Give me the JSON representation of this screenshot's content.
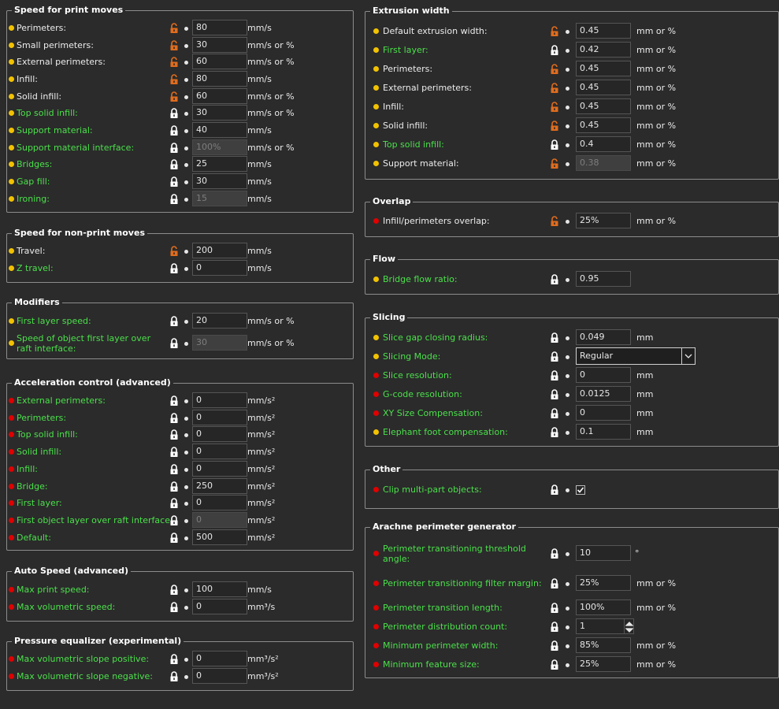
{
  "colors": {
    "accent_green": "#4be04b",
    "unlock_orange": "#e06c1d",
    "bullet_yellow": "#f2c200",
    "bullet_red": "#e00000"
  },
  "left_groups": [
    {
      "title": "Speed for print moves",
      "rows": [
        {
          "bullet": "yellow",
          "label": "Perimeters:",
          "green": false,
          "lock": "unlocked",
          "value": "80",
          "disabled": false,
          "unit": "mm/s"
        },
        {
          "bullet": "yellow",
          "label": "Small perimeters:",
          "green": false,
          "lock": "unlocked",
          "value": "30",
          "disabled": false,
          "unit": "mm/s or %"
        },
        {
          "bullet": "yellow",
          "label": "External perimeters:",
          "green": false,
          "lock": "unlocked",
          "value": "60",
          "disabled": false,
          "unit": "mm/s or %"
        },
        {
          "bullet": "yellow",
          "label": "Infill:",
          "green": false,
          "lock": "unlocked",
          "value": "80",
          "disabled": false,
          "unit": "mm/s"
        },
        {
          "bullet": "yellow",
          "label": "Solid infill:",
          "green": false,
          "lock": "unlocked",
          "value": "60",
          "disabled": false,
          "unit": "mm/s or %"
        },
        {
          "bullet": "yellow",
          "label": "Top solid infill:",
          "green": true,
          "lock": "locked",
          "value": "30",
          "disabled": false,
          "unit": "mm/s or %"
        },
        {
          "bullet": "yellow",
          "label": "Support material:",
          "green": true,
          "lock": "locked",
          "value": "40",
          "disabled": false,
          "unit": "mm/s"
        },
        {
          "bullet": "yellow",
          "label": "Support material interface:",
          "green": true,
          "lock": "locked",
          "value": "100%",
          "disabled": true,
          "unit": "mm/s or %"
        },
        {
          "bullet": "yellow",
          "label": "Bridges:",
          "green": true,
          "lock": "locked",
          "value": "25",
          "disabled": false,
          "unit": "mm/s"
        },
        {
          "bullet": "yellow",
          "label": "Gap fill:",
          "green": true,
          "lock": "locked",
          "value": "30",
          "disabled": false,
          "unit": "mm/s"
        },
        {
          "bullet": "yellow",
          "label": "Ironing:",
          "green": true,
          "lock": "locked",
          "value": "15",
          "disabled": true,
          "unit": "mm/s"
        }
      ]
    },
    {
      "title": "Speed for non-print moves",
      "rows": [
        {
          "bullet": "yellow",
          "label": "Travel:",
          "green": false,
          "lock": "unlocked",
          "value": "200",
          "disabled": false,
          "unit": "mm/s"
        },
        {
          "bullet": "yellow",
          "label": "Z travel:",
          "green": true,
          "lock": "locked",
          "value": "0",
          "disabled": false,
          "unit": "mm/s"
        }
      ]
    },
    {
      "title": "Modifiers",
      "rows": [
        {
          "bullet": "yellow",
          "label": "First layer speed:",
          "green": true,
          "lock": "locked",
          "value": "20",
          "disabled": false,
          "unit": "mm/s or %"
        },
        {
          "bullet": "yellow",
          "label": "Speed of object first layer over raft interface:",
          "green": true,
          "lock": "locked",
          "value": "30",
          "disabled": true,
          "unit": "mm/s or %",
          "two_line": true
        }
      ]
    },
    {
      "title": "Acceleration control (advanced)",
      "rows": [
        {
          "bullet": "red",
          "label": "External perimeters:",
          "green": true,
          "lock": "locked",
          "value": "0",
          "disabled": false,
          "unit": "mm/s²"
        },
        {
          "bullet": "red",
          "label": "Perimeters:",
          "green": true,
          "lock": "locked",
          "value": "0",
          "disabled": false,
          "unit": "mm/s²"
        },
        {
          "bullet": "red",
          "label": "Top solid infill:",
          "green": true,
          "lock": "locked",
          "value": "0",
          "disabled": false,
          "unit": "mm/s²"
        },
        {
          "bullet": "red",
          "label": "Solid infill:",
          "green": true,
          "lock": "locked",
          "value": "0",
          "disabled": false,
          "unit": "mm/s²"
        },
        {
          "bullet": "red",
          "label": "Infill:",
          "green": true,
          "lock": "locked",
          "value": "0",
          "disabled": false,
          "unit": "mm/s²"
        },
        {
          "bullet": "red",
          "label": "Bridge:",
          "green": true,
          "lock": "locked",
          "value": "250",
          "disabled": false,
          "unit": "mm/s²"
        },
        {
          "bullet": "red",
          "label": "First layer:",
          "green": true,
          "lock": "locked",
          "value": "0",
          "disabled": false,
          "unit": "mm/s²"
        },
        {
          "bullet": "red",
          "label": "First object layer over raft interface:",
          "green": true,
          "lock": "locked",
          "value": "0",
          "disabled": true,
          "unit": "mm/s²"
        },
        {
          "bullet": "red",
          "label": "Default:",
          "green": true,
          "lock": "locked",
          "value": "500",
          "disabled": false,
          "unit": "mm/s²"
        }
      ]
    },
    {
      "title": "Auto Speed (advanced)",
      "rows": [
        {
          "bullet": "red",
          "label": "Max print speed:",
          "green": true,
          "lock": "locked",
          "value": "100",
          "disabled": false,
          "unit": "mm/s"
        },
        {
          "bullet": "red",
          "label": "Max volumetric speed:",
          "green": true,
          "lock": "locked",
          "value": "0",
          "disabled": false,
          "unit": "mm³/s"
        }
      ]
    },
    {
      "title": "Pressure equalizer (experimental)",
      "rows": [
        {
          "bullet": "red",
          "label": "Max volumetric slope positive:",
          "green": true,
          "lock": "locked",
          "value": "0",
          "disabled": false,
          "unit": "mm³/s²"
        },
        {
          "bullet": "red",
          "label": "Max volumetric slope negative:",
          "green": true,
          "lock": "locked",
          "value": "0",
          "disabled": false,
          "unit": "mm³/s²"
        }
      ]
    }
  ],
  "right_groups": [
    {
      "title": "Extrusion width",
      "rows": [
        {
          "bullet": "yellow",
          "label": "Default extrusion width:",
          "green": false,
          "lock": "unlocked",
          "value": "0.45",
          "disabled": false,
          "unit": "mm or %"
        },
        {
          "bullet": "yellow",
          "label": "First layer:",
          "green": true,
          "lock": "locked",
          "value": "0.42",
          "disabled": false,
          "unit": "mm or %"
        },
        {
          "bullet": "yellow",
          "label": "Perimeters:",
          "green": false,
          "lock": "unlocked",
          "value": "0.45",
          "disabled": false,
          "unit": "mm or %"
        },
        {
          "bullet": "yellow",
          "label": "External perimeters:",
          "green": false,
          "lock": "unlocked",
          "value": "0.45",
          "disabled": false,
          "unit": "mm or %"
        },
        {
          "bullet": "yellow",
          "label": "Infill:",
          "green": false,
          "lock": "unlocked",
          "value": "0.45",
          "disabled": false,
          "unit": "mm or %"
        },
        {
          "bullet": "yellow",
          "label": "Solid infill:",
          "green": false,
          "lock": "unlocked",
          "value": "0.45",
          "disabled": false,
          "unit": "mm or %"
        },
        {
          "bullet": "yellow",
          "label": "Top solid infill:",
          "green": true,
          "lock": "locked",
          "value": "0.4",
          "disabled": false,
          "unit": "mm or %"
        },
        {
          "bullet": "yellow",
          "label": "Support material:",
          "green": false,
          "lock": "unlocked",
          "value": "0.38",
          "disabled": true,
          "unit": "mm or %"
        }
      ]
    },
    {
      "title": "Overlap",
      "rows": [
        {
          "bullet": "red",
          "label": "Infill/perimeters overlap:",
          "green": false,
          "lock": "unlocked",
          "value": "25%",
          "disabled": false,
          "unit": "mm or %"
        }
      ]
    },
    {
      "title": "Flow",
      "rows": [
        {
          "bullet": "yellow",
          "label": "Bridge flow ratio:",
          "green": true,
          "lock": "locked",
          "value": "0.95",
          "disabled": false,
          "unit": ""
        }
      ]
    },
    {
      "title": "Slicing",
      "rows": [
        {
          "bullet": "yellow",
          "label": "Slice gap closing radius:",
          "green": true,
          "lock": "locked",
          "value": "0.049",
          "disabled": false,
          "unit": "mm"
        },
        {
          "bullet": "yellow",
          "label": "Slicing Mode:",
          "green": true,
          "lock": "locked",
          "value": "Regular",
          "disabled": false,
          "unit": "",
          "select": true
        },
        {
          "bullet": "red",
          "label": "Slice resolution:",
          "green": true,
          "lock": "locked",
          "value": "0",
          "disabled": false,
          "unit": "mm"
        },
        {
          "bullet": "red",
          "label": "G-code resolution:",
          "green": true,
          "lock": "locked",
          "value": "0.0125",
          "disabled": false,
          "unit": "mm"
        },
        {
          "bullet": "red",
          "label": "XY Size Compensation:",
          "green": true,
          "lock": "locked",
          "value": "0",
          "disabled": false,
          "unit": "mm"
        },
        {
          "bullet": "yellow",
          "label": "Elephant foot compensation:",
          "green": true,
          "lock": "locked",
          "value": "0.1",
          "disabled": false,
          "unit": "mm"
        }
      ]
    },
    {
      "title": "Other",
      "rows": [
        {
          "bullet": "red",
          "label": "Clip multi-part objects:",
          "green": true,
          "lock": "locked",
          "value": "",
          "disabled": false,
          "unit": "",
          "checkbox": true,
          "checked": true
        }
      ]
    },
    {
      "title": "Arachne perimeter generator",
      "rows": [
        {
          "bullet": "red",
          "label": "Perimeter transitioning threshold angle:",
          "green": true,
          "lock": "locked",
          "value": "10",
          "disabled": false,
          "unit": "°",
          "two_line": true
        },
        {
          "bullet": "red",
          "label": "Perimeter transitioning filter margin:",
          "green": true,
          "lock": "locked",
          "value": "25%",
          "disabled": false,
          "unit": "mm or %"
        },
        {
          "bullet": "red",
          "label": "Perimeter transition length:",
          "green": true,
          "lock": "locked",
          "value": "100%",
          "disabled": false,
          "unit": "mm or %"
        },
        {
          "bullet": "red",
          "label": "Perimeter distribution count:",
          "green": true,
          "lock": "locked",
          "value": "1",
          "disabled": false,
          "unit": "",
          "spin": true
        },
        {
          "bullet": "red",
          "label": "Minimum perimeter width:",
          "green": true,
          "lock": "locked",
          "value": "85%",
          "disabled": false,
          "unit": "mm or %"
        },
        {
          "bullet": "red",
          "label": "Minimum feature size:",
          "green": true,
          "lock": "locked",
          "value": "25%",
          "disabled": false,
          "unit": "mm or %"
        }
      ]
    }
  ]
}
